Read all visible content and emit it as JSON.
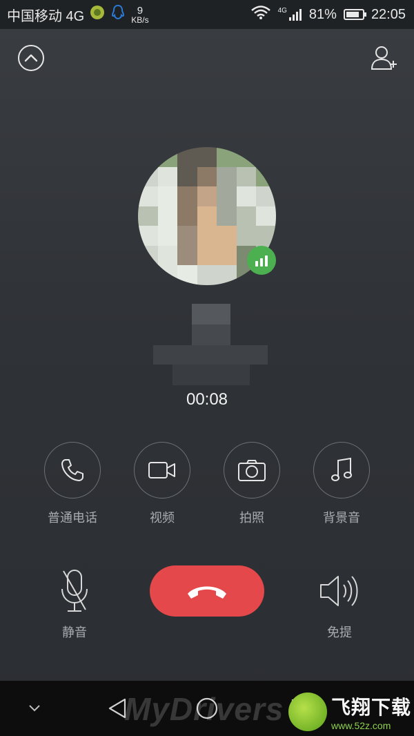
{
  "status_bar": {
    "carrier": "中国移动 4G",
    "speed_value": "9",
    "speed_unit": "KB/s",
    "network": "4G",
    "battery": "81%",
    "battery_level": 0.81,
    "time": "22:05"
  },
  "call": {
    "duration": "00:08"
  },
  "features": [
    {
      "label": "普通电话",
      "icon": "phone-icon"
    },
    {
      "label": "视频",
      "icon": "video-camera-icon"
    },
    {
      "label": "拍照",
      "icon": "camera-icon"
    },
    {
      "label": "背景音",
      "icon": "music-note-icon"
    }
  ],
  "controls": {
    "mute_label": "静音",
    "speaker_label": "免提"
  },
  "watermark": {
    "text": "MyDrivers",
    "logo_text": "飞翔下载",
    "logo_url": "www.52z.com"
  },
  "colors": {
    "hangup": "#e5484a",
    "signal_badge": "#4caf50",
    "background": "#2e3135"
  }
}
